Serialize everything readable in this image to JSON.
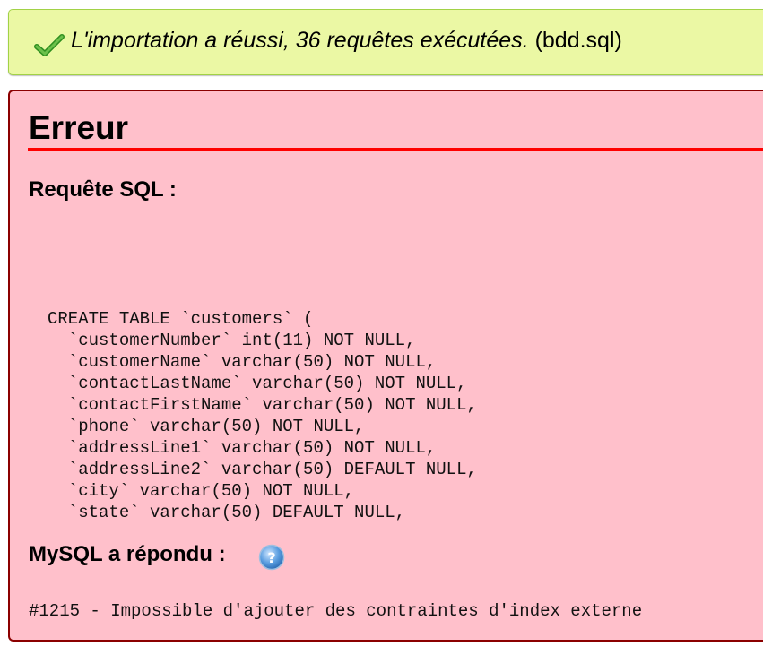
{
  "success": {
    "icon": "checkmark-icon",
    "message": "L'importation a réussi, 36 requêtes exécutées.",
    "file": "(bdd.sql)"
  },
  "error": {
    "title": "Erreur",
    "sql_label": "Requête SQL :",
    "sql_lines": [
      "CREATE TABLE `customers` (",
      "  `customerNumber` int(11) NOT NULL,",
      "  `customerName` varchar(50) NOT NULL,",
      "  `contactLastName` varchar(50) NOT NULL,",
      "  `contactFirstName` varchar(50) NOT NULL,",
      "  `phone` varchar(50) NOT NULL,",
      "  `addressLine1` varchar(50) NOT NULL,",
      "  `addressLine2` varchar(50) DEFAULT NULL,",
      "  `city` varchar(50) NOT NULL,",
      "  `state` varchar(50) DEFAULT NULL,"
    ],
    "mysql_label": "MySQL a répondu :",
    "help_icon": "help-icon",
    "response": "#1215 - Impossible d'ajouter des contraintes d'index externe"
  },
  "colors": {
    "success_bg": "#ebf8a4",
    "success_border": "#a2d246",
    "error_bg": "#ffc0cb",
    "error_border": "#8b0000",
    "error_rule": "#ff0000"
  }
}
